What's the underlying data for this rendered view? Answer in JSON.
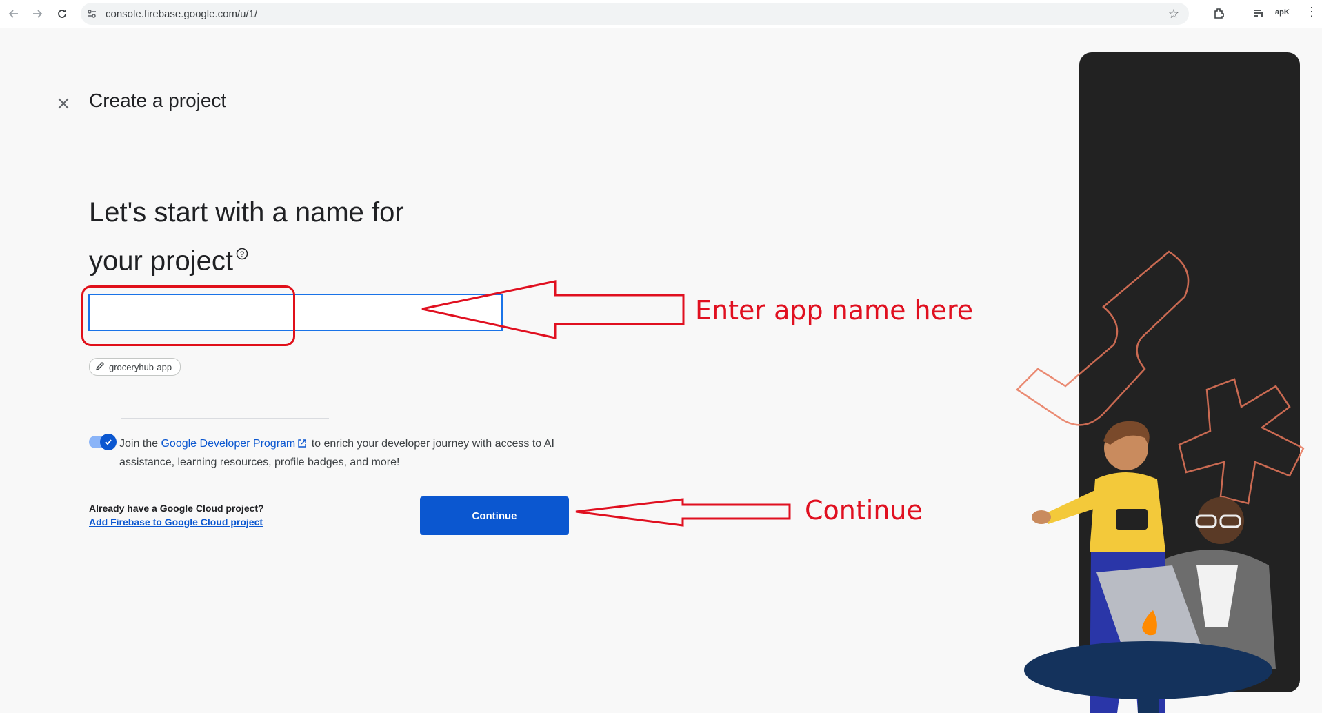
{
  "browser": {
    "url": "console.firebase.google.com/u/1/",
    "ext_label": "apK"
  },
  "header": {
    "title": "Create a project"
  },
  "form": {
    "headline_line1": "Let's start with a name for",
    "headline_line2": "your project",
    "name_value": "",
    "project_id": "groceryhub-app"
  },
  "developer_program": {
    "text_before": "Join the ",
    "link": "Google Developer Program",
    "text_after": " to enrich your developer journey with access to AI assistance, learning resources, profile badges, and more!",
    "enabled": true
  },
  "cloud": {
    "question": "Already have a Google Cloud project?",
    "link": "Add Firebase to Google Cloud project"
  },
  "actions": {
    "continue_label": "Continue"
  },
  "annotations": {
    "name_hint": "Enter app name here",
    "continue_hint": "Continue",
    "color": "#e01020"
  },
  "colors": {
    "primary": "#0b57d0",
    "panel": "#222222"
  }
}
